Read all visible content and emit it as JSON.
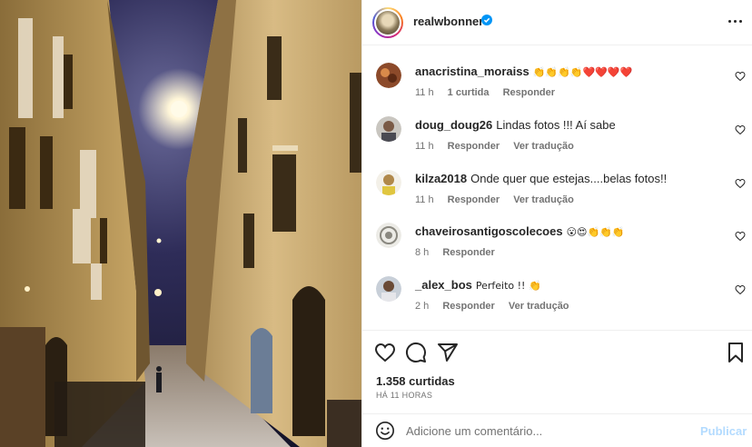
{
  "post": {
    "username": "realwbonner",
    "verified": true,
    "more_icon": "more-horizontal-icon",
    "photo_description_icon": "street-photo"
  },
  "comments": [
    {
      "user": "anacristina_moraiss",
      "text": "👏👏👏👏❤️❤️❤️❤️",
      "time": "11 h",
      "likes": "1 curtida",
      "reply": "Responder",
      "translate": ""
    },
    {
      "user": "doug_doug26",
      "text": "Lindas fotos !!! Aí sabe",
      "time": "11 h",
      "likes": "",
      "reply": "Responder",
      "translate": "Ver tradução"
    },
    {
      "user": "kilza2018",
      "text": "Onde quer que estejas....belas fotos!!",
      "time": "11 h",
      "likes": "",
      "reply": "Responder",
      "translate": "Ver tradução"
    },
    {
      "user": "chaveirosantigoscolecoes",
      "text": "😮😍👏👏👏",
      "time": "8 h",
      "likes": "",
      "reply": "Responder",
      "translate": ""
    },
    {
      "user": "_alex_bos",
      "text": "Perfeito !! 👏",
      "time": "2 h",
      "likes": "",
      "reply": "Responder",
      "translate": "Ver tradução"
    }
  ],
  "actions": {
    "like_icon": "heart-icon",
    "comment_icon": "comment-icon",
    "share_icon": "share-icon",
    "save_icon": "bookmark-icon",
    "likes_count": "1.358 curtidas",
    "posted": "HÁ 11 HORAS"
  },
  "add_comment": {
    "placeholder": "Adicione um comentário...",
    "publish_label": "Publicar",
    "publish_color": "#b3dbff"
  }
}
